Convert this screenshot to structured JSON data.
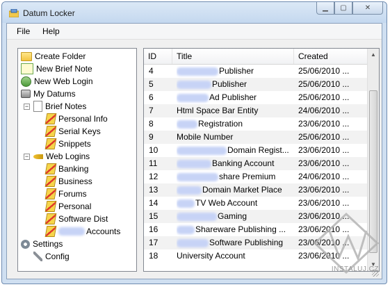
{
  "window": {
    "title": "Datum Locker"
  },
  "menu": [
    "File",
    "Help"
  ],
  "tree": {
    "create_folder": "Create Folder",
    "new_brief_note": "New Brief Note",
    "new_web_login": "New Web Login",
    "my_datums": "My Datums",
    "brief_notes": "Brief Notes",
    "personal_info": "Personal Info",
    "serial_keys": "Serial Keys",
    "snippets": "Snippets",
    "web_logins": "Web Logins",
    "banking": "Banking",
    "business": "Business",
    "forums": "Forums",
    "personal": "Personal",
    "software_dist": "Software Dist",
    "accounts": "Accounts",
    "settings": "Settings",
    "config": "Config"
  },
  "table": {
    "headers": {
      "id": "ID",
      "title": "Title",
      "created": "Created"
    },
    "rows": [
      {
        "id": "4",
        "title": "Publisher",
        "created": "25/06/2010 ..."
      },
      {
        "id": "5",
        "title": "Publisher",
        "created": "25/06/2010 ..."
      },
      {
        "id": "6",
        "title": "Ad Publisher",
        "created": "25/06/2010 ..."
      },
      {
        "id": "7",
        "title": "Html Space Bar Entity",
        "created": "24/06/2010 ..."
      },
      {
        "id": "8",
        "title": "Registration",
        "created": "23/06/2010 ..."
      },
      {
        "id": "9",
        "title": "Mobile Number",
        "created": "25/06/2010 ..."
      },
      {
        "id": "10",
        "title": "Domain Regist...",
        "created": "23/06/2010 ..."
      },
      {
        "id": "11",
        "title": "Banking Account",
        "created": "23/06/2010 ..."
      },
      {
        "id": "12",
        "title": "share Premium",
        "created": "24/06/2010 ..."
      },
      {
        "id": "13",
        "title": "Domain Market Place",
        "created": "23/06/2010 ..."
      },
      {
        "id": "14",
        "title": "TV Web Account",
        "created": "23/06/2010 ..."
      },
      {
        "id": "15",
        "title": "Gaming",
        "created": "23/06/2010 ..."
      },
      {
        "id": "16",
        "title": "Shareware Publishing ...",
        "created": "23/06/2010 ..."
      },
      {
        "id": "17",
        "title": "Software Publishing",
        "created": "23/06/2010 ..."
      },
      {
        "id": "18",
        "title": "University Account",
        "created": "23/06/2010 ..."
      }
    ]
  },
  "watermark": "INSTALUJ.CZ"
}
